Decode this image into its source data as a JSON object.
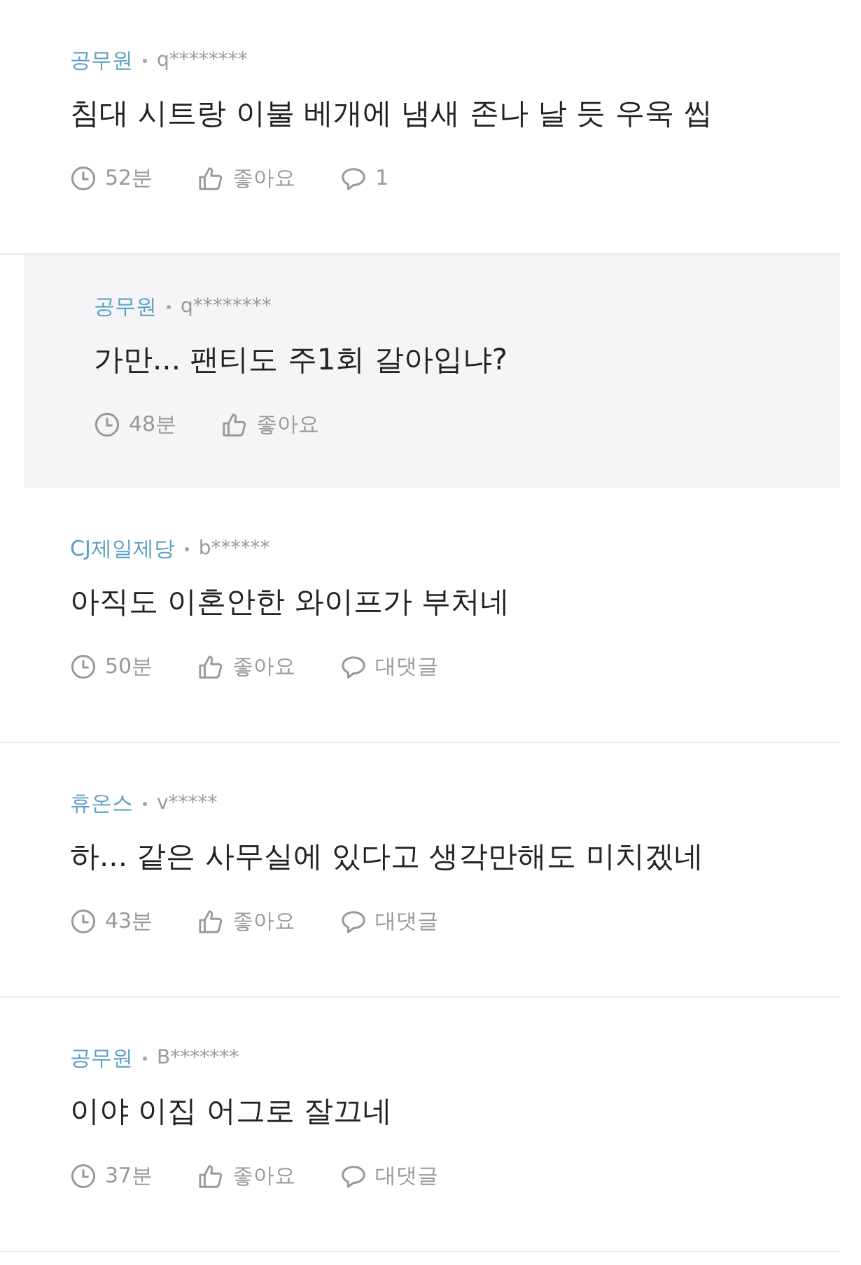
{
  "comments": [
    {
      "kind": "comment",
      "company": "공무원",
      "user": "q********",
      "text": "침대 시트랑 이불 베개에 냄새 존나 날 듯 우욱 씹",
      "time": "52분",
      "like": "좋아요",
      "reply": "1"
    },
    {
      "kind": "reply",
      "company": "공무원",
      "user": "q********",
      "text": "가만... 팬티도 주1회 갈아입냐?",
      "time": "48분",
      "like": "좋아요"
    },
    {
      "kind": "comment",
      "company": "CJ제일제당",
      "user": "b******",
      "text": "아직도 이혼안한 와이프가 부처네",
      "time": "50분",
      "like": "좋아요",
      "reply": "대댓글"
    },
    {
      "kind": "comment",
      "company": "휴온스",
      "user": "v*****",
      "text": "하... 같은 사무실에 있다고 생각만해도 미치겠네",
      "time": "43분",
      "like": "좋아요",
      "reply": "대댓글"
    },
    {
      "kind": "comment",
      "company": "공무원",
      "user": "B*******",
      "text": "이야 이집 어그로 잘끄네",
      "time": "37분",
      "like": "좋아요",
      "reply": "대댓글"
    }
  ]
}
